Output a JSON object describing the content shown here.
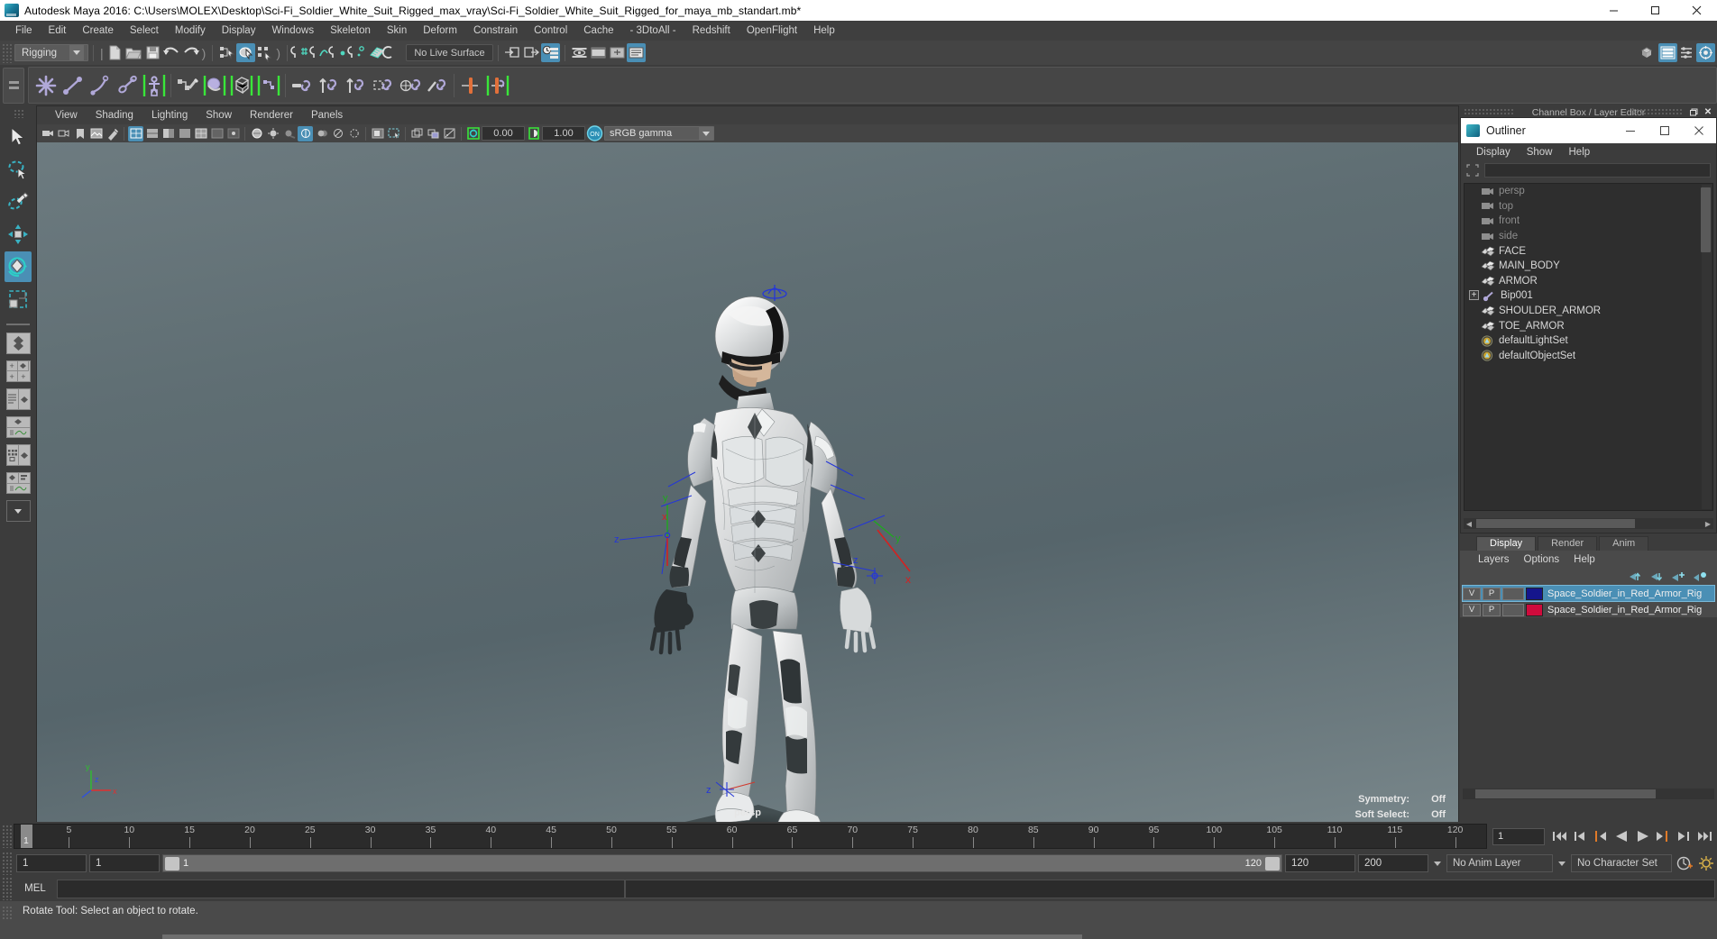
{
  "titlebar": {
    "text": "Autodesk Maya 2016: C:\\Users\\MOLEX\\Desktop\\Sci-Fi_Soldier_White_Suit_Rigged_max_vray\\Sci-Fi_Soldier_White_Suit_Rigged_for_maya_mb_standart.mb*",
    "app_icon": "maya-icon",
    "minimize": "minimize-icon",
    "maximize": "maximize-icon",
    "close": "close-icon"
  },
  "menubar": {
    "items": [
      "File",
      "Edit",
      "Create",
      "Select",
      "Modify",
      "Display",
      "Windows",
      "Skeleton",
      "Skin",
      "Deform",
      "Constrain",
      "Control",
      "Cache",
      "- 3DtoAll -",
      "Redshift",
      "OpenFlight",
      "Help"
    ]
  },
  "statusline": {
    "menuset": "Rigging",
    "live_surface": "No Live Surface",
    "icons": [
      "new-scene-icon",
      "open-scene-icon",
      "save-scene-icon",
      "undo-icon",
      "redo-icon",
      "select-hierarchy-icon",
      "select-object-icon",
      "select-component-icon",
      "snap-grid-icon",
      "snap-curve-icon",
      "snap-point-icon",
      "snap-projected-icon",
      "snap-view-plane-icon",
      "make-live-icon",
      "input-connections-icon",
      "output-connections-icon",
      "construction-history-icon",
      "render-view-icon",
      "render-sequence-icon",
      "ipr-render-icon",
      "render-settings-icon",
      "hypershade-icon",
      "editor-layout-icon",
      "attribute-editor-icon",
      "tool-settings-icon",
      "channel-box-icon"
    ]
  },
  "shelf": {
    "icons": [
      "create-joint-icon",
      "ik-handle-icon",
      "ik-spline-icon",
      "insert-joint-icon",
      "quick-rig-icon",
      "paint-skin-weights-icon",
      "bind-skin-icon",
      "lattice-deform-icon",
      "cluster-deform-icon",
      "parent-constraint-icon",
      "point-constraint-icon",
      "orient-constraint-icon",
      "scale-constraint-icon",
      "aim-constraint-icon",
      "pole-vector-icon",
      "mirror-joint-icon",
      "connect-joint-icon"
    ]
  },
  "toolbox": {
    "tools": [
      {
        "name": "select-tool",
        "label": "Select Tool",
        "selected": false
      },
      {
        "name": "lasso-select-tool",
        "label": "Lasso Select Tool",
        "selected": false
      },
      {
        "name": "paint-select-tool",
        "label": "Paint Select Tool",
        "selected": false
      },
      {
        "name": "move-tool",
        "label": "Move Tool",
        "selected": false
      },
      {
        "name": "rotate-tool",
        "label": "Rotate Tool",
        "selected": true
      },
      {
        "name": "scale-tool",
        "label": "Scale Tool",
        "selected": false
      }
    ],
    "layouts": [
      "single-perspective-layout",
      "four-view-layout",
      "persp-outliner-layout",
      "persp-graph-editor-layout",
      "hypershade-persp-layout",
      "persp-graph-outliner-layout"
    ]
  },
  "viewport": {
    "menus": [
      "View",
      "Shading",
      "Lighting",
      "Show",
      "Renderer",
      "Panels"
    ],
    "exposure_value": "0.00",
    "gamma_value": "1.00",
    "color_management": "sRGB gamma",
    "camera_label": "persp",
    "hud": [
      {
        "label": "Symmetry:",
        "value": "Off"
      },
      {
        "label": "Soft Select:",
        "value": "Off"
      }
    ],
    "gnomon_axes": [
      "x",
      "y",
      "z"
    ],
    "manipulator_axis_labels": [
      "X",
      "Y",
      "Z"
    ]
  },
  "channelbox_header": "Channel Box / Layer Editor",
  "outliner": {
    "title": "Outliner",
    "window_icon": "outliner-icon",
    "minimize": "minimize-icon",
    "maximize": "maximize-icon",
    "close": "close-icon",
    "menus": [
      "Display",
      "Show",
      "Help"
    ],
    "search_value": "",
    "search_placeholder": "",
    "items": [
      {
        "label": "persp",
        "icon": "camera-icon",
        "type": "camera",
        "dim": true,
        "expandable": false
      },
      {
        "label": "top",
        "icon": "camera-icon",
        "type": "camera",
        "dim": true,
        "expandable": false
      },
      {
        "label": "front",
        "icon": "camera-icon",
        "type": "camera",
        "dim": true,
        "expandable": false
      },
      {
        "label": "side",
        "icon": "camera-icon",
        "type": "camera",
        "dim": true,
        "expandable": false
      },
      {
        "label": "FACE",
        "icon": "mesh-icon",
        "type": "mesh",
        "dim": false,
        "expandable": false
      },
      {
        "label": "MAIN_BODY",
        "icon": "mesh-icon",
        "type": "mesh",
        "dim": false,
        "expandable": false
      },
      {
        "label": "ARMOR",
        "icon": "mesh-icon",
        "type": "mesh",
        "dim": false,
        "expandable": false
      },
      {
        "label": "Bip001",
        "icon": "joint-icon",
        "type": "joint",
        "dim": false,
        "expandable": true
      },
      {
        "label": "SHOULDER_ARMOR",
        "icon": "mesh-icon",
        "type": "mesh",
        "dim": false,
        "expandable": false
      },
      {
        "label": "TOE_ARMOR",
        "icon": "mesh-icon",
        "type": "mesh",
        "dim": false,
        "expandable": false
      },
      {
        "label": "defaultLightSet",
        "icon": "set-icon",
        "type": "set",
        "dim": false,
        "expandable": false
      },
      {
        "label": "defaultObjectSet",
        "icon": "set-icon",
        "type": "set",
        "dim": false,
        "expandable": false
      }
    ]
  },
  "layer_editor": {
    "tabs": [
      {
        "label": "Display",
        "selected": true
      },
      {
        "label": "Render",
        "selected": false
      },
      {
        "label": "Anim",
        "selected": false
      }
    ],
    "menus": [
      "Layers",
      "Options",
      "Help"
    ],
    "tool_icons": [
      "move-layer-up-icon",
      "move-layer-down-icon",
      "new-layer-icon",
      "new-layer-from-selected-icon"
    ],
    "layers": [
      {
        "visibility": "V",
        "playback": "P",
        "state": "",
        "color": "#15158c",
        "name": "Space_Soldier_in_Red_Armor_Rig",
        "selected": true
      },
      {
        "visibility": "V",
        "playback": "P",
        "state": "",
        "color": "#cf0b3c",
        "name": "Space_Soldier_in_Red_Armor_Rig",
        "selected": false
      }
    ]
  },
  "timeline": {
    "start_label": "1",
    "current_frame": "1",
    "ticks": [
      5,
      10,
      15,
      20,
      25,
      30,
      35,
      40,
      45,
      50,
      55,
      60,
      65,
      70,
      75,
      80,
      85,
      90,
      95,
      100,
      105,
      110,
      115,
      120
    ],
    "range_start": 1,
    "range_end": 120,
    "playback_buttons": [
      "go-to-start-icon",
      "step-back-keyframe-icon",
      "step-back-frame-icon",
      "play-backwards-icon",
      "play-forwards-icon",
      "step-forward-frame-icon",
      "step-forward-keyframe-icon",
      "go-to-end-icon"
    ]
  },
  "range_slider": {
    "anim_start": "1",
    "range_start": "1",
    "slider_left_label": "1",
    "slider_right_label": "120",
    "range_end": "120",
    "anim_end": "200",
    "anim_layer": "No Anim Layer",
    "character_set": "No Character Set",
    "icons": [
      "auto-keyframe-icon",
      "animation-preferences-icon"
    ]
  },
  "command_line": {
    "language_label": "MEL",
    "input_value": "",
    "output_value": ""
  },
  "help_line": {
    "text": "Rotate Tool: Select an object to rotate."
  },
  "colors": {
    "accent": "#4a8fb5",
    "viewport_bg": "#5f6e73",
    "panel_bg": "#3c3c3c",
    "list_bg": "#2e2e2e",
    "axis_x": "#e03030",
    "axis_y": "#2fbf2f",
    "axis_z": "#3050e0"
  }
}
